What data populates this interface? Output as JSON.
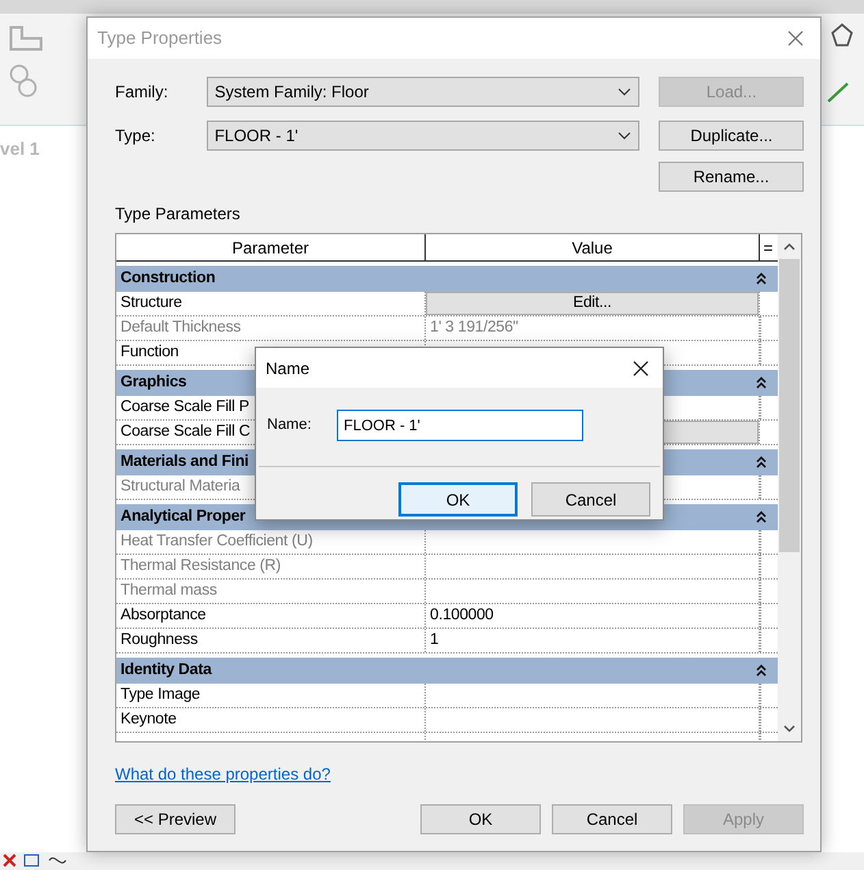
{
  "background": {
    "view_label": "vel 1"
  },
  "dialog": {
    "title": "Type Properties",
    "fields": [
      {
        "label": "Family:",
        "value": "System Family: Floor"
      },
      {
        "label": "Type:",
        "value": "FLOOR - 1'"
      }
    ],
    "side_buttons": [
      {
        "label": "Load...",
        "disabled": true
      },
      {
        "label": "Duplicate...",
        "disabled": false
      },
      {
        "label": "Rename...",
        "disabled": false
      }
    ],
    "section_label": "Type Parameters",
    "grid": {
      "columns": [
        "Parameter",
        "Value",
        "="
      ],
      "rows": [
        {
          "kind": "group",
          "label": "Construction",
          "expanded": true
        },
        {
          "kind": "button",
          "name": "Structure",
          "value": "Edit...",
          "disabled": false
        },
        {
          "kind": "text",
          "name": "Default Thickness",
          "value": "1'  3 191/256\"",
          "disabled": true
        },
        {
          "kind": "text",
          "name": "Function",
          "disabled": false
        },
        {
          "kind": "group",
          "label": "Graphics",
          "expanded": true
        },
        {
          "kind": "text",
          "name": "Coarse Scale Fill P",
          "disabled": false
        },
        {
          "kind": "button",
          "name": "Coarse Scale Fill C",
          "disabled": false
        },
        {
          "kind": "group",
          "label": "Materials and Fini",
          "expanded": true
        },
        {
          "kind": "text",
          "name": "Structural Materia",
          "disabled": true
        },
        {
          "kind": "group",
          "label": "Analytical Proper",
          "expanded": true
        },
        {
          "kind": "text",
          "name": "Heat Transfer Coefficient (U)",
          "disabled": true
        },
        {
          "kind": "text",
          "name": "Thermal Resistance (R)",
          "disabled": true
        },
        {
          "kind": "text",
          "name": "Thermal mass",
          "disabled": true
        },
        {
          "kind": "text",
          "name": "Absorptance",
          "value": "0.100000",
          "disabled": false
        },
        {
          "kind": "text",
          "name": "Roughness",
          "value": "1",
          "disabled": false
        },
        {
          "kind": "group",
          "label": "Identity Data",
          "expanded": true
        },
        {
          "kind": "text",
          "name": "Type Image",
          "disabled": false
        },
        {
          "kind": "text",
          "name": "Keynote",
          "disabled": false
        },
        {
          "kind": "text"
        }
      ]
    },
    "help_link": "What do these properties do?",
    "footer_buttons": [
      {
        "label": "<< Preview",
        "disabled": false
      },
      {
        "label": "OK",
        "disabled": false
      },
      {
        "label": "Cancel",
        "disabled": false
      },
      {
        "label": "Apply",
        "disabled": true
      }
    ]
  },
  "name_dialog": {
    "title": "Name",
    "label": "Name:",
    "value": "FLOOR - 1'",
    "buttons": [
      {
        "label": "OK",
        "default": true
      },
      {
        "label": "Cancel",
        "default": false
      }
    ]
  }
}
